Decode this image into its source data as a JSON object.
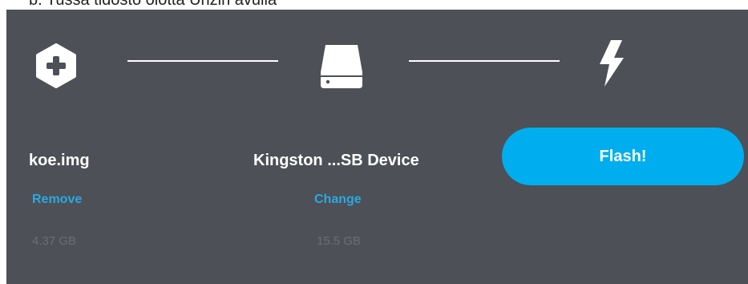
{
  "caption": "b. Tussa tidosto olotta Unzin avulla",
  "steps": {
    "image": {
      "icon": "add-hexagon-icon",
      "name": "koe.img",
      "action": "Remove",
      "size": "4.37 GB"
    },
    "drive": {
      "icon": "drive-icon",
      "name": "Kingston ...SB Device",
      "action": "Change",
      "size": "15.5 GB"
    },
    "flash": {
      "icon": "lightning-icon",
      "button_label": "Flash!"
    }
  },
  "colors": {
    "panel_bg": "#4d5057",
    "accent": "#00aeef",
    "link": "#2aa9e0",
    "muted_text": "#6b6e75",
    "icon": "#ffffff"
  }
}
